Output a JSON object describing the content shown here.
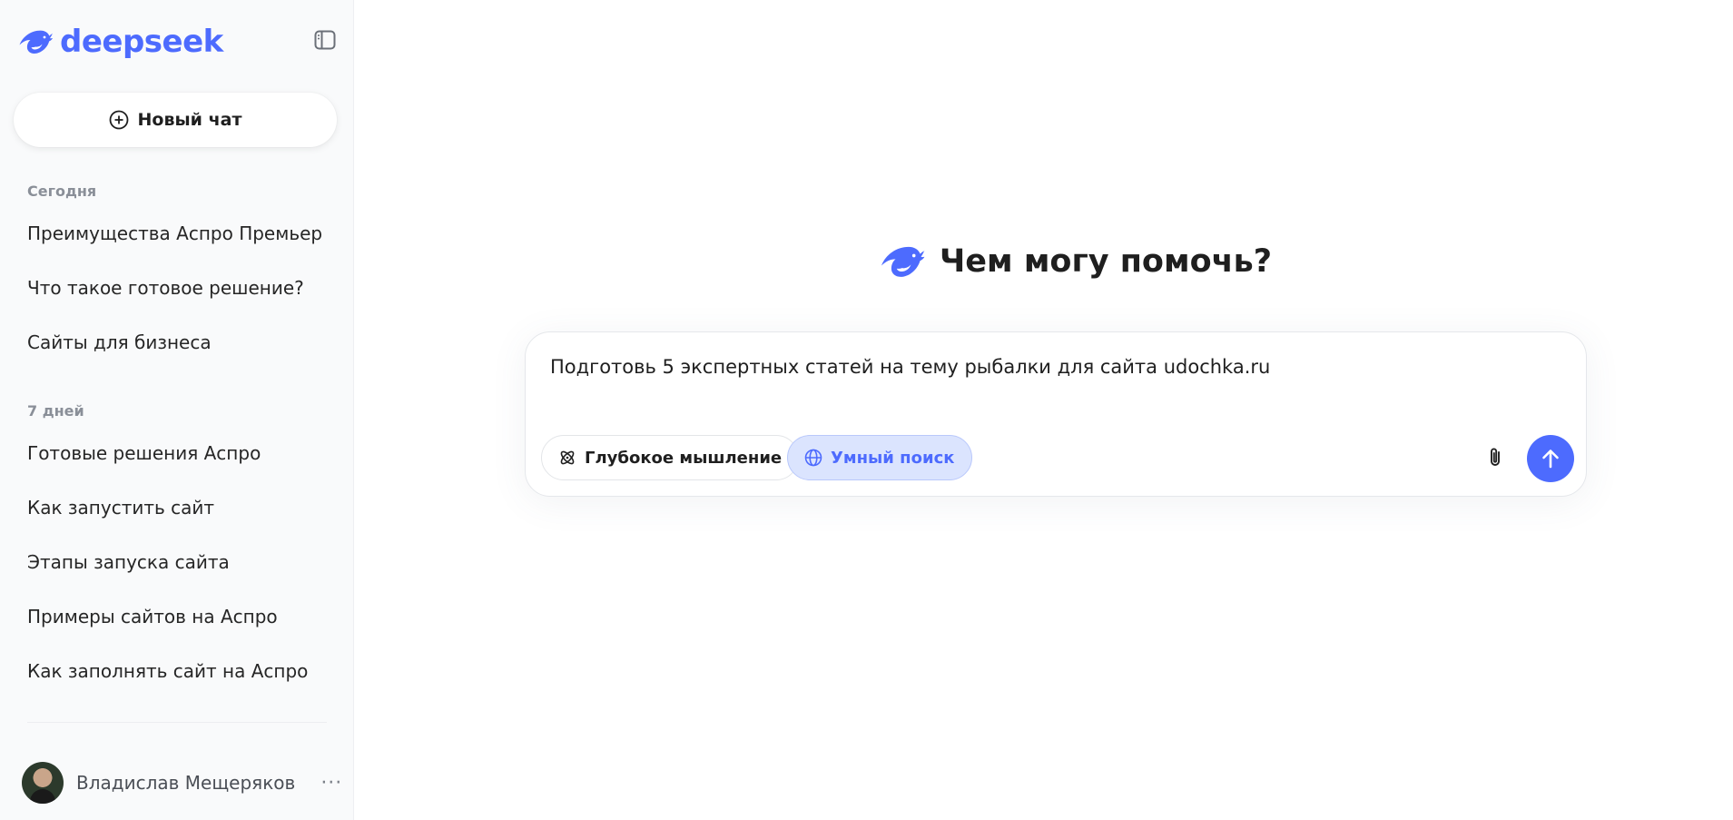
{
  "app": {
    "logo_text": "deepseek",
    "brand_color": "#4d6bfe"
  },
  "sidebar": {
    "toggle_icon": "sidebar-toggle-icon",
    "new_chat_label": "Новый чат",
    "sections": [
      {
        "label": "Сегодня",
        "items": [
          "Преимущества Аспро Премьер",
          "Что такое готовое решение?",
          "Сайты для бизнеса"
        ]
      },
      {
        "label": "7 дней",
        "items": [
          "Готовые решения Аспро",
          "Как запустить сайт",
          "Этапы запуска сайта",
          "Примеры сайтов на Аспро",
          "Как заполнять сайт на Аспро"
        ]
      }
    ],
    "user": {
      "name": "Владислав Мещеряков",
      "more": "···"
    }
  },
  "main": {
    "greeting": "Чем могу помочь?",
    "composer": {
      "text": "Подготовь 5 экспертных статей на тему рыбалки для сайта udochka.ru",
      "deep_think_label": "Глубокое мышление",
      "search_label": "Умный поиск",
      "search_active": true,
      "attach_icon": "paperclip-icon",
      "send_icon": "arrow-up-icon"
    }
  }
}
